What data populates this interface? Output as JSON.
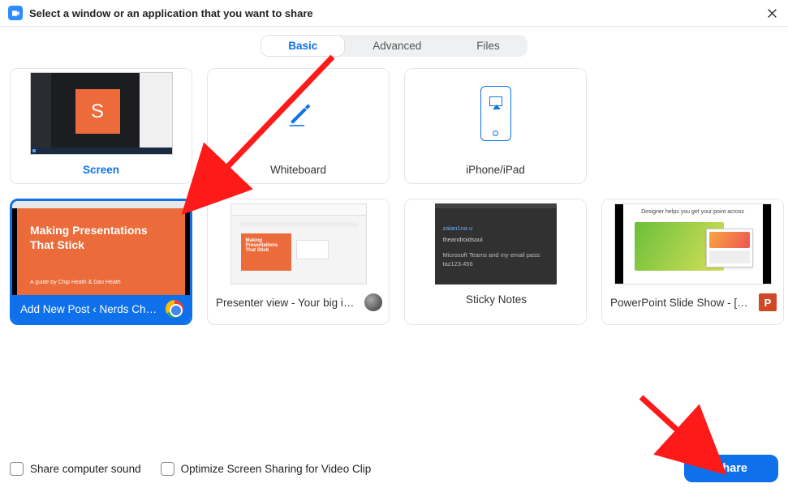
{
  "header": {
    "title": "Select a window or an application that you want to share"
  },
  "tabs": {
    "basic": "Basic",
    "advanced": "Advanced",
    "files": "Files",
    "active": "basic"
  },
  "tiles": {
    "screen": {
      "label": "Screen"
    },
    "whiteboard": {
      "label": "Whiteboard"
    },
    "iphone": {
      "label": "iPhone/iPad"
    },
    "chrome_window": {
      "label": "Add New Post ‹ Nerds Chalk — …",
      "slide_title": "Making Presentations That Stick",
      "slide_sub": "A guide by Chip Heath & Dan Heath",
      "selected": true
    },
    "presenter_view": {
      "label": "Presenter view - Your big idea - G…",
      "mini_title": "Making Presentations That Stick"
    },
    "sticky_notes": {
      "label": "Sticky Notes",
      "line1": "zalan1na u",
      "line2": "theandroidsoul",
      "line3": "Microsoft Teams and my email pass: taz123.456"
    },
    "powerpoint": {
      "label": "PowerPoint Slide Show - [Present…",
      "head": "Designer helps you get your point across"
    }
  },
  "footer": {
    "share_sound": "Share computer sound",
    "optimize": "Optimize Screen Sharing for Video Clip",
    "share_btn": "Share"
  },
  "icons": {
    "zoom": "zoom-icon",
    "close": "close-icon",
    "pen": "pen-icon",
    "airplay": "airplay-icon",
    "chrome": "chrome-icon",
    "sphere": "sphere-icon",
    "sticky": "sticky-note-icon",
    "powerpoint": "powerpoint-icon"
  }
}
